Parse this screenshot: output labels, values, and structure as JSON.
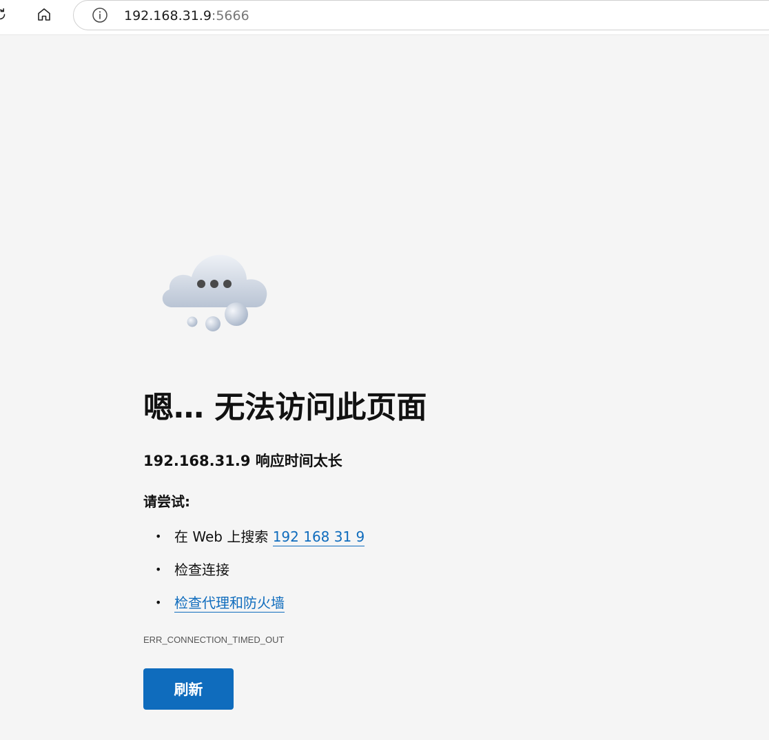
{
  "browser": {
    "address_bar": {
      "host": "192.168.31.9",
      "port": ":5666"
    },
    "icons": {
      "refresh": "refresh-icon",
      "home": "home-icon",
      "site_info": "info-icon"
    }
  },
  "error_page": {
    "illustration": "cloud-ellipsis-icon",
    "title": "嗯… 无法访问此页面",
    "subtitle": "192.168.31.9 响应时间太长",
    "try_label": "请尝试:",
    "suggestions": [
      {
        "prefix": "在 Web 上搜索 ",
        "link": "192 168 31 9"
      },
      {
        "text": "检查连接"
      },
      {
        "link": "检查代理和防火墙"
      }
    ],
    "error_code": "ERR_CONNECTION_TIMED_OUT",
    "reload_label": "刷新"
  },
  "colors": {
    "link": "#0f6cbd",
    "button": "#0f6cbd",
    "background": "#f5f5f5"
  }
}
